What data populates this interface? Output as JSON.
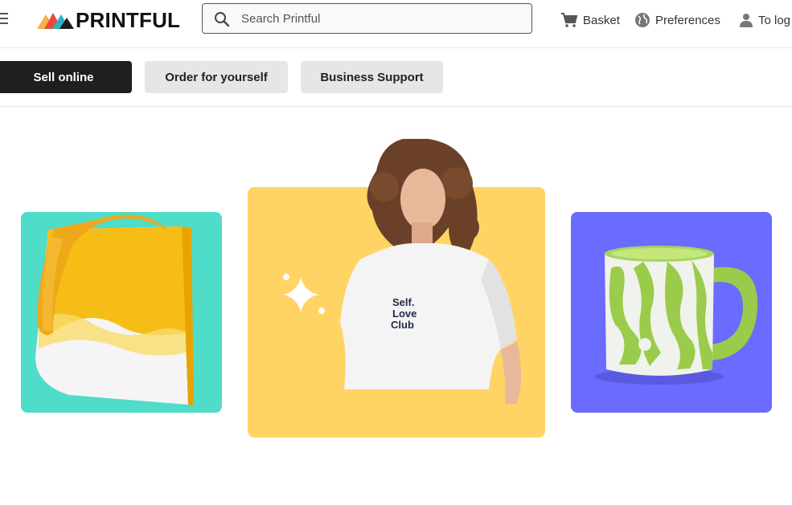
{
  "header": {
    "logo_text": "PRINTFUL",
    "search": {
      "placeholder": "Search Printful",
      "value": ""
    },
    "nav": {
      "basket": "Basket",
      "preferences": "Preferences",
      "login": "To log"
    }
  },
  "tabs": [
    {
      "label": "Sell online",
      "active": true
    },
    {
      "label": "Order for yourself",
      "active": false
    },
    {
      "label": "Business Support",
      "active": false
    }
  ],
  "hero": {
    "tote_bg": "#4fdcc9",
    "tshirt_bg": "#ffd464",
    "mug_bg": "#6b6bff",
    "tshirt_print": [
      "Self.",
      "Love",
      "Club"
    ]
  },
  "icons": [
    "menu-icon",
    "logo-mark-icon",
    "search-icon",
    "basket-icon",
    "globe-icon",
    "user-icon",
    "sparkle-icon"
  ]
}
